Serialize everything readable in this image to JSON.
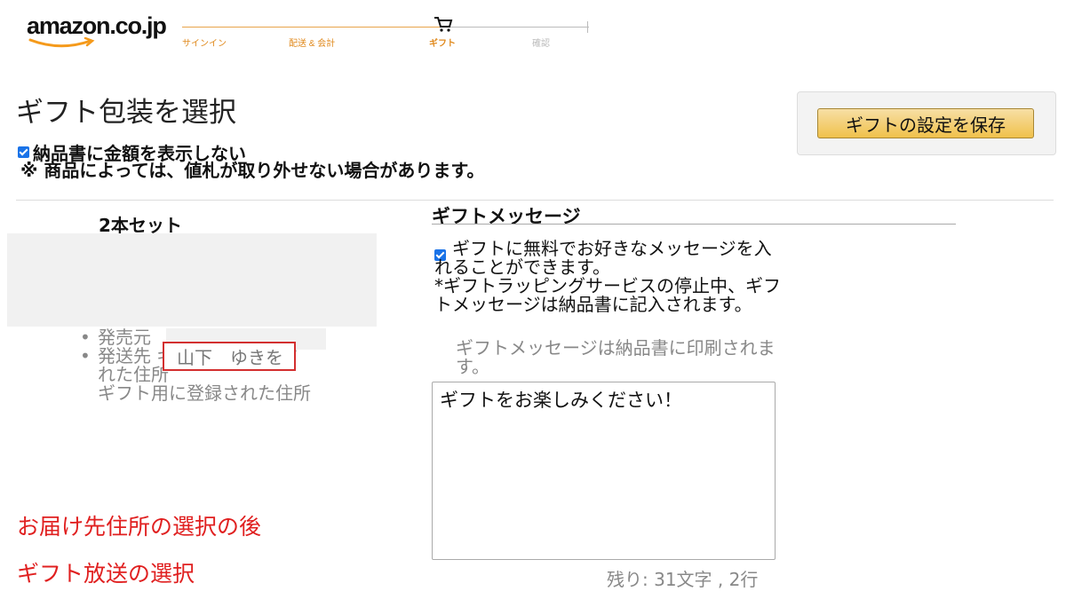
{
  "header": {
    "logo_text": "amazon.co.jp",
    "steps": [
      {
        "label": "サインイン",
        "state": "done"
      },
      {
        "label": "配送 & 会計",
        "state": "done"
      },
      {
        "label": "ギフト",
        "state": "active"
      },
      {
        "label": "確認",
        "state": "todo"
      }
    ]
  },
  "page": {
    "title": "ギフト包装を選択",
    "hide_price_label": "納品書に金額を表示しない",
    "hide_price_checked": true,
    "price_tag_note": "※ 商品によっては、値札が取り外せない場合があります。",
    "save_button": "ギフトの設定を保存"
  },
  "item": {
    "name": "2本セット",
    "seller_label": "発売元",
    "ship_to_label": "発送先",
    "ship_to_desc": "ギフト用に登録された住所",
    "ship_to_desc_repeat": "ギフト用に登録された住所",
    "recipient": "山下　ゆきを"
  },
  "annotations": {
    "note1": "お届け先住所の選択の後",
    "note2": "ギフト放送の選択"
  },
  "message": {
    "heading": "ギフトメッセージ",
    "enable_label": "ギフトに無料でお好きなメッセージを入れることができます。",
    "service_note": "*ギフトラッピングサービスの停止中、ギフトメッセージは納品書に記入されます。",
    "print_note": "ギフトメッセージは納品書に印刷されます。",
    "text": "ギフトをお楽しみください！",
    "remaining": "残り: 31文字 , 2行"
  },
  "colors": {
    "accent_orange": "#e08a1e",
    "annotation_red": "#e02020",
    "button_yellow": "#f0c14b",
    "checkbox_blue": "#1a73e8"
  }
}
